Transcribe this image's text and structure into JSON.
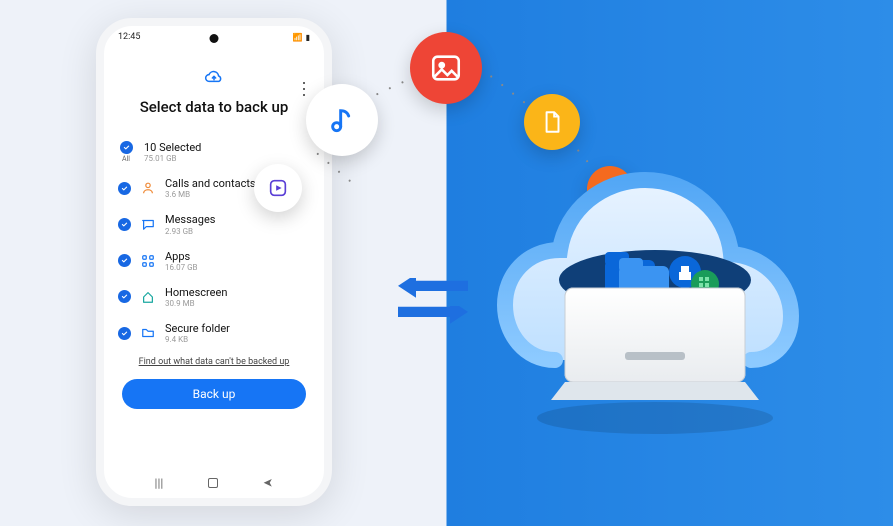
{
  "statusbar": {
    "time": "12:45"
  },
  "header": {
    "title": "Select data to back up"
  },
  "items": [
    {
      "label": "10 Selected",
      "sub": "75.01 GB",
      "all": "All",
      "icon": "none"
    },
    {
      "label": "Calls and contacts",
      "sub": "3.6 MB",
      "icon": "contact"
    },
    {
      "label": "Messages",
      "sub": "2.93 GB",
      "icon": "message"
    },
    {
      "label": "Apps",
      "sub": "16.07 GB",
      "icon": "apps"
    },
    {
      "label": "Homescreen",
      "sub": "30.9 MB",
      "icon": "home"
    },
    {
      "label": "Secure folder",
      "sub": "9.4 KB",
      "icon": "folder"
    }
  ],
  "link_text": "Find out what data can't be backed up",
  "button_label": "Back up"
}
